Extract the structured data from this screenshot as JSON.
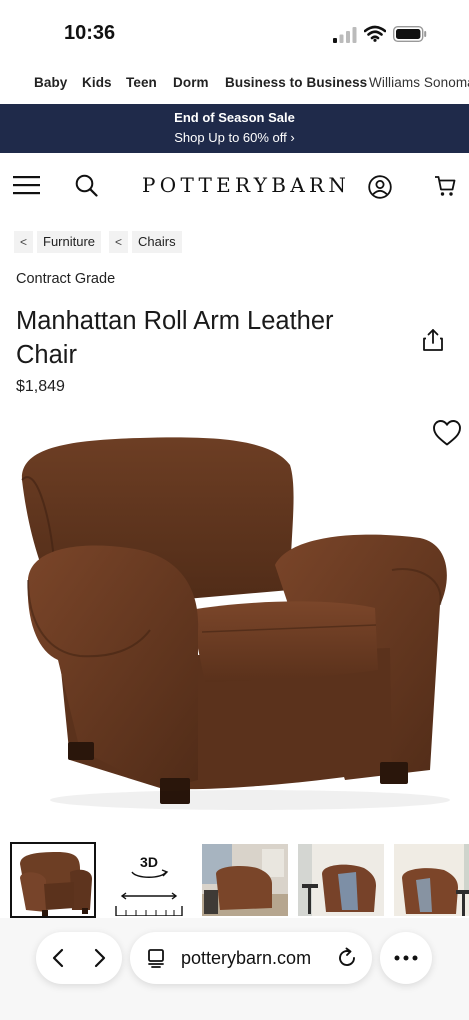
{
  "status": {
    "time": "10:36"
  },
  "category_nav": [
    "Baby",
    "Kids",
    "Teen",
    "Dorm",
    "Business to Business",
    "Williams Sonoma"
  ],
  "promo": {
    "line1": "End of Season Sale",
    "line2": "Shop Up to 60% off ›"
  },
  "header": {
    "logo": "POTTERYBARN"
  },
  "breadcrumb": [
    {
      "sep": "<",
      "label": "Furniture"
    },
    {
      "sep": "<",
      "label": "Chairs"
    }
  ],
  "product": {
    "grade": "Contract Grade",
    "title": "Manhattan Roll Arm Leather Chair",
    "price": "$1,849"
  },
  "thumbnails": {
    "label_3d": "3D"
  },
  "browser": {
    "url": "potterybarn.com"
  },
  "icons": [
    "signal-icon",
    "wifi-icon",
    "battery-icon",
    "menu-icon",
    "search-icon",
    "account-icon",
    "cart-icon",
    "share-icon",
    "heart-icon",
    "back-icon",
    "forward-icon",
    "tabs-icon",
    "reload-icon",
    "more-icon"
  ],
  "colors": {
    "promo_bg": "#1f2a4a",
    "leather": "#6e3f25"
  }
}
